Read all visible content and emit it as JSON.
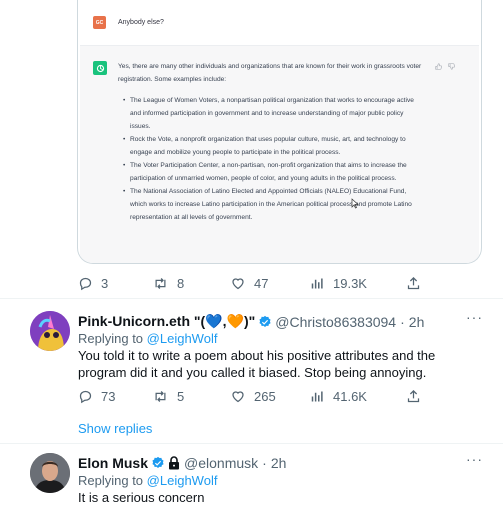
{
  "embedded_chat": {
    "user_initials": "GC",
    "user_message": "Anybody else?",
    "assistant_intro": "Yes, there are many other individuals and organizations that are known for their work in grassroots voter registration. Some examples include:",
    "assistant_items": [
      "The League of Women Voters, a nonpartisan political organization that works to encourage active and informed participation in government and to increase understanding of major public policy issues.",
      "Rock the Vote, a nonprofit organization that uses popular culture, music, art, and technology to engage and mobilize young people to participate in the political process.",
      "The Voter Participation Center, a non-partisan, non-profit organization that aims to increase the participation of unmarried women, people of color, and young adults in the political process.",
      "The National Association of Latino Elected and Appointed Officials (NALEO) Educational Fund, which works to increase Latino participation in the American political process and promote Latino representation at all levels of government."
    ]
  },
  "main_tweet_actions": {
    "replies": "3",
    "retweets": "8",
    "likes": "47",
    "views": "19.3K"
  },
  "reply1": {
    "name": "Pink-Unicorn.eth \"(💙,🧡)\"",
    "handle": "@Christo86383094",
    "separator": "·",
    "time": "2h",
    "replying_label": "Replying to",
    "replying_to": "@LeighWolf",
    "text": "You told it to write a poem about his positive attributes and the program did it and you called it biased. Stop being annoying.",
    "replies": "73",
    "retweets": "5",
    "likes": "265",
    "views": "41.6K",
    "show_replies": "Show replies",
    "more": "···"
  },
  "reply2": {
    "name": "Elon Musk",
    "handle": "@elonmusk",
    "separator": "·",
    "time": "2h",
    "replying_label": "Replying to",
    "replying_to": "@LeighWolf",
    "text": "It is a serious concern",
    "more": "···"
  },
  "colors": {
    "accent": "#1d9bf0",
    "secondary_text": "#536471",
    "verified": "#1d9bf0",
    "gpt_green": "#19c37d",
    "user_avatar": "#e8724a"
  }
}
